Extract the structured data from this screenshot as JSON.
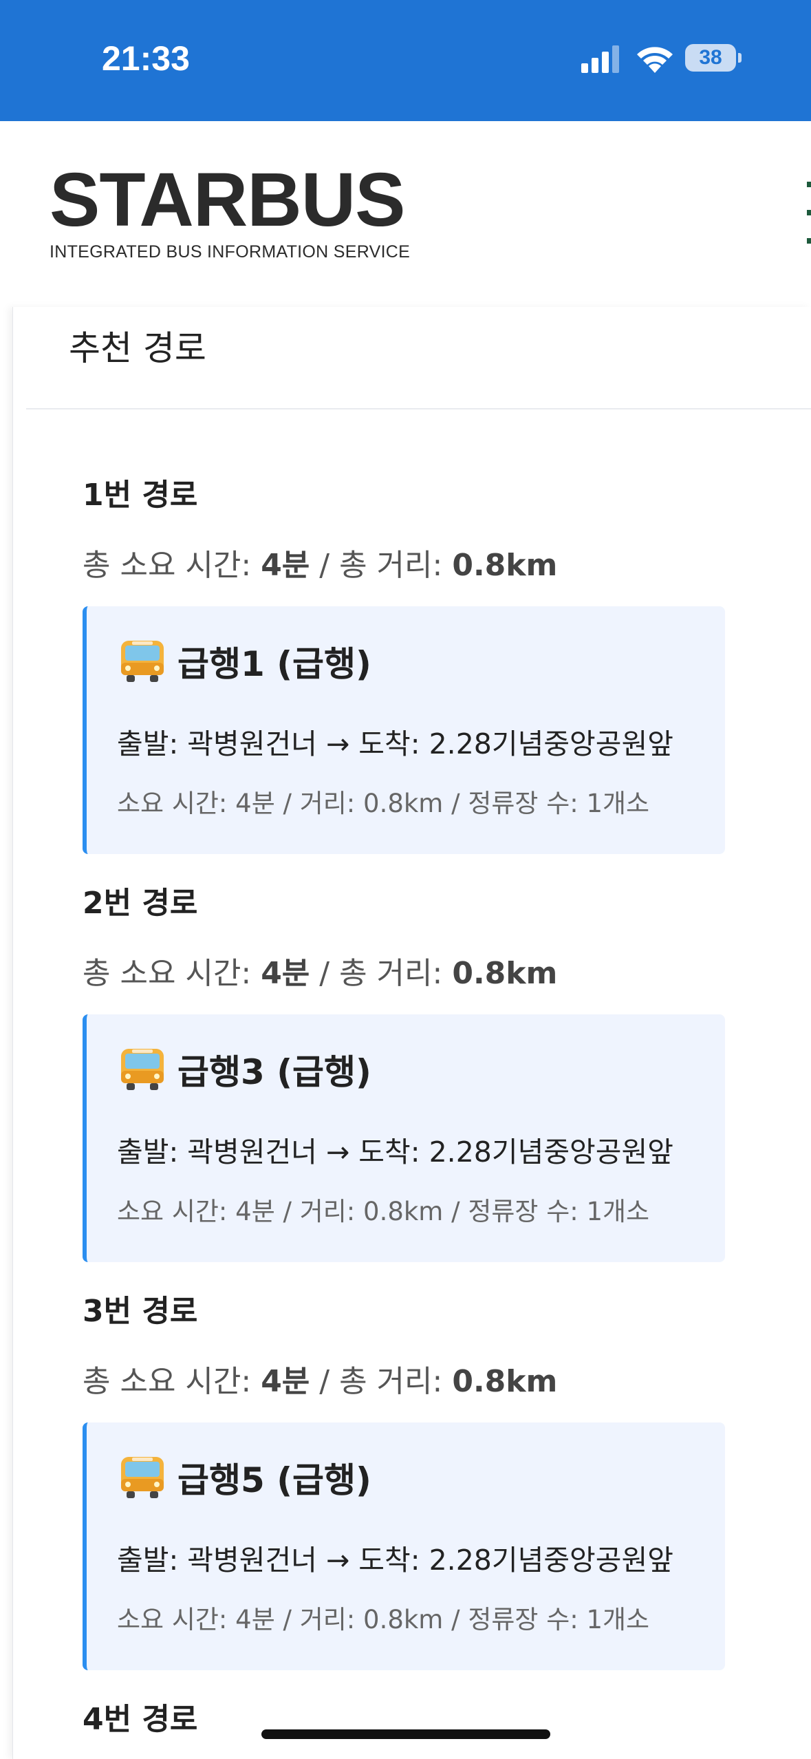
{
  "status_bar": {
    "time": "21:33",
    "battery": "38",
    "signal_icon": "cellular-signal-icon",
    "wifi_icon": "wifi-icon",
    "background": "#1f74d4"
  },
  "header": {
    "logo": "STARBUS",
    "tagline": "INTEGRATED BUS INFORMATION SERVICE"
  },
  "panel": {
    "title": "추천 경로"
  },
  "routes": [
    {
      "title": "1번 경로",
      "summary_time_label": "총 소요 시간: ",
      "summary_time": "4분",
      "summary_sep": " / 총 거리: ",
      "summary_distance": "0.8km",
      "leg": {
        "icon": "bus-icon",
        "name": "급행1 (급행)",
        "stops": "출발: 곽병원건너 → 도착: 2.28기념중앙공원앞",
        "meta": "소요 시간: 4분 / 거리: 0.8km / 정류장 수: 1개소"
      }
    },
    {
      "title": "2번 경로",
      "summary_time_label": "총 소요 시간: ",
      "summary_time": "4분",
      "summary_sep": " / 총 거리: ",
      "summary_distance": "0.8km",
      "leg": {
        "icon": "bus-icon",
        "name": "급행3 (급행)",
        "stops": "출발: 곽병원건너 → 도착: 2.28기념중앙공원앞",
        "meta": "소요 시간: 4분 / 거리: 0.8km / 정류장 수: 1개소"
      }
    },
    {
      "title": "3번 경로",
      "summary_time_label": "총 소요 시간: ",
      "summary_time": "4분",
      "summary_sep": " / 총 거리: ",
      "summary_distance": "0.8km",
      "leg": {
        "icon": "bus-icon",
        "name": "급행5 (급행)",
        "stops": "출발: 곽병원건너 → 도착: 2.28기념중앙공원앞",
        "meta": "소요 시간: 4분 / 거리: 0.8km / 정류장 수: 1개소"
      }
    },
    {
      "title": "4번 경로"
    }
  ],
  "colors": {
    "accent": "#2b8ef0",
    "card_background": "#eff4fe"
  }
}
